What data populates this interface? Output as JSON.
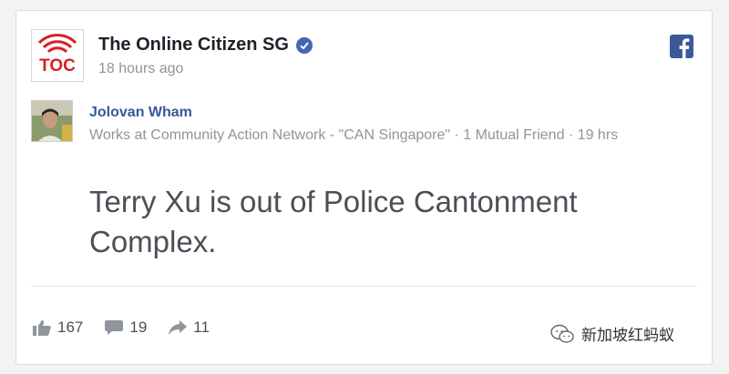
{
  "header": {
    "logo_text": "TOC",
    "page_name": "The Online Citizen SG",
    "post_time": "18 hours ago"
  },
  "embedded_post": {
    "author_name": "Jolovan Wham",
    "author_meta": "Works at Community Action Network - \"CAN Singapore\" · 1 Mutual Friend · 19 hrs",
    "status_text": "Terry Xu is out of Police Cantonment Complex."
  },
  "footer": {
    "likes": "167",
    "comments": "19",
    "shares": "11"
  },
  "watermark": {
    "text": "新加坡红蚂蚁"
  },
  "colors": {
    "brand_red": "#d71f26",
    "facebook_blue": "#3b5998",
    "verified_blue": "#4267b2",
    "link_blue": "#365899"
  }
}
